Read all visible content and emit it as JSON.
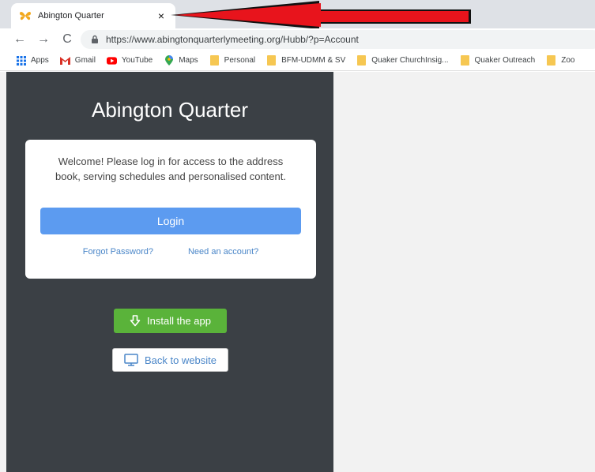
{
  "browser": {
    "tab": {
      "title": "Abington Quarter",
      "close_glyph": "×",
      "favicon": "butterfly-icon"
    },
    "toolbar": {
      "back_glyph": "←",
      "forward_glyph": "→",
      "reload_glyph": "C",
      "url": "https://www.abingtonquarterlymeeting.org/Hubb/?p=Account"
    },
    "bookmarks": [
      {
        "label": "Apps",
        "icon": "apps-grid-icon"
      },
      {
        "label": "Gmail",
        "icon": "gmail-icon"
      },
      {
        "label": "YouTube",
        "icon": "youtube-icon"
      },
      {
        "label": "Maps",
        "icon": "maps-icon"
      },
      {
        "label": "Personal",
        "icon": "folder-icon"
      },
      {
        "label": "BFM-UDMM & SV",
        "icon": "folder-icon"
      },
      {
        "label": "Quaker ChurchInsig...",
        "icon": "folder-icon"
      },
      {
        "label": "Quaker Outreach",
        "icon": "folder-icon"
      },
      {
        "label": "Zoo",
        "icon": "folder-icon"
      }
    ]
  },
  "page": {
    "site_title": "Abington Quarter",
    "login_card": {
      "welcome": "Welcome! Please log in for access to the address book, serving schedules and personalised content.",
      "login_label": "Login",
      "forgot_label": "Forgot Password?",
      "need_account_label": "Need an account?"
    },
    "install_label": "Install the app",
    "back_label": "Back to website"
  },
  "colors": {
    "panel_bg": "#3b4045",
    "login_button": "#5c9bf0",
    "install_button": "#5ab33a",
    "link": "#4a86c8",
    "annotation_arrow": "#e8141c"
  }
}
